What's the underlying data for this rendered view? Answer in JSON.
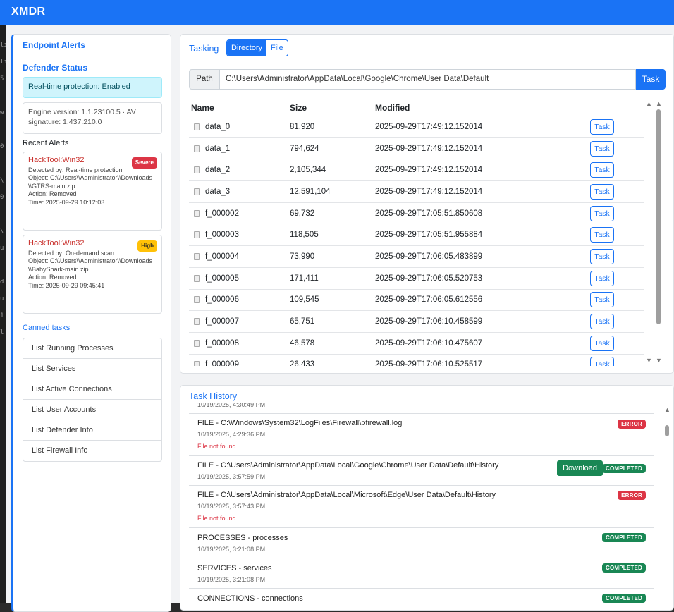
{
  "app": {
    "title": "XMDR"
  },
  "background_terminal": [
    "li",
    "li",
    "5",
    "",
    "w",
    "",
    "0",
    "",
    "\\",
    "0",
    "",
    "\\",
    "u",
    "",
    "d",
    "u",
    "1",
    "l"
  ],
  "sidebar": {
    "endpoint_alerts_title": "Endpoint Alerts",
    "defender_status_title": "Defender Status",
    "realtime_status": "Real-time protection: Enabled",
    "engine_info": "Engine version: 1.1.23100.5 · AV signature: 1.437.210.0",
    "recent_alerts_label": "Recent Alerts",
    "alerts": [
      {
        "name": "HackTool:Win32",
        "severity": "Severe",
        "detected_by": "Detected by: Real-time protection",
        "object": "Object: C:\\\\Users\\\\Administrator\\\\Downloads\\\\GTRS-main.zip",
        "action": "Action: Removed",
        "time": "Time: 2025-09-29 10:12:03"
      },
      {
        "name": "HackTool:Win32",
        "severity": "High",
        "detected_by": "Detected by: On-demand scan",
        "object": "Object: C:\\\\Users\\\\Administrator\\\\Downloads\\\\BabyShark-main.zip",
        "action": "Action: Removed",
        "time": "Time: 2025-09-29 09:45:41"
      }
    ],
    "canned_tasks_title": "Canned tasks",
    "canned_tasks": [
      "List Running Processes",
      "List Services",
      "List Active Connections",
      "List User Accounts",
      "List Defender Info",
      "List Firewall Info"
    ]
  },
  "tasking": {
    "title": "Tasking",
    "modes": [
      "Directory",
      "File"
    ],
    "active_mode": "Directory",
    "path_label": "Path",
    "path_value": "C:\\Users\\Administrator\\AppData\\Local\\Google\\Chrome\\User Data\\Default",
    "task_button": "Task",
    "columns": [
      "Name",
      "Size",
      "Modified"
    ],
    "row_action": "Task",
    "rows": [
      {
        "name": "data_0",
        "size": "81,920",
        "modified": "2025-09-29T17:49:12.152014"
      },
      {
        "name": "data_1",
        "size": "794,624",
        "modified": "2025-09-29T17:49:12.152014"
      },
      {
        "name": "data_2",
        "size": "2,105,344",
        "modified": "2025-09-29T17:49:12.152014"
      },
      {
        "name": "data_3",
        "size": "12,591,104",
        "modified": "2025-09-29T17:49:12.152014"
      },
      {
        "name": "f_000002",
        "size": "69,732",
        "modified": "2025-09-29T17:05:51.850608"
      },
      {
        "name": "f_000003",
        "size": "118,505",
        "modified": "2025-09-29T17:05:51.955884"
      },
      {
        "name": "f_000004",
        "size": "73,990",
        "modified": "2025-09-29T17:06:05.483899"
      },
      {
        "name": "f_000005",
        "size": "171,411",
        "modified": "2025-09-29T17:06:05.520753"
      },
      {
        "name": "f_000006",
        "size": "109,545",
        "modified": "2025-09-29T17:06:05.612556"
      },
      {
        "name": "f_000007",
        "size": "65,751",
        "modified": "2025-09-29T17:06:10.458599"
      },
      {
        "name": "f_000008",
        "size": "46,578",
        "modified": "2025-09-29T17:06:10.475607"
      },
      {
        "name": "f_000009",
        "size": "26,433",
        "modified": "2025-09-29T17:06:10.525517"
      }
    ]
  },
  "history": {
    "title": "Task History",
    "partial_time": "10/19/2025, 4:30:49 PM",
    "download_label": "Download",
    "items": [
      {
        "title": "FILE - C:\\Windows\\System32\\LogFiles\\Firewall\\pfirewall.log",
        "time": "10/19/2025, 4:29:36 PM",
        "status": "ERROR",
        "error": "File not found"
      },
      {
        "title": "FILE - C:\\Users\\Administrator\\AppData\\Local\\Google\\Chrome\\User Data\\Default\\History",
        "time": "10/19/2025, 3:57:59 PM",
        "status": "COMPLETED",
        "error": ""
      },
      {
        "title": "FILE - C:\\Users\\Administrator\\AppData\\Local\\Microsoft\\Edge\\User Data\\Default\\History",
        "time": "10/19/2025, 3:57:43 PM",
        "status": "ERROR",
        "error": "File not found"
      },
      {
        "title": "PROCESSES - processes",
        "time": "10/19/2025, 3:21:08 PM",
        "status": "COMPLETED",
        "error": ""
      },
      {
        "title": "SERVICES - services",
        "time": "10/19/2025, 3:21:08 PM",
        "status": "COMPLETED",
        "error": ""
      },
      {
        "title": "CONNECTIONS - connections",
        "time": "",
        "status": "COMPLETED",
        "error": ""
      }
    ]
  }
}
